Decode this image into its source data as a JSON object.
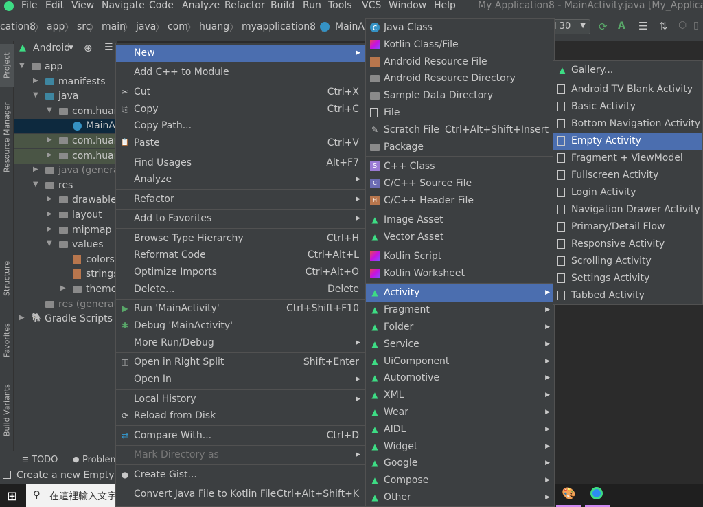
{
  "menubar": {
    "items": [
      "File",
      "Edit",
      "View",
      "Navigate",
      "Code",
      "Analyze",
      "Refactor",
      "Build",
      "Run",
      "Tools",
      "VCS",
      "Window",
      "Help"
    ],
    "title": "My Application8 - MainActivity.java [My_Applicatio"
  },
  "navbar": {
    "crumbs": [
      "cation8",
      "app",
      "src",
      "main",
      "java",
      "com",
      "huang",
      "myapplication8",
      "MainAc"
    ],
    "run_config": "l 30"
  },
  "left_strip": {
    "tabs": [
      "Project",
      "Resource Manager",
      "Structure",
      "Favorites",
      "Build Variants"
    ]
  },
  "project": {
    "view_selector": "Android",
    "tree": [
      {
        "label": "app",
        "indent": 0,
        "arrow": "down",
        "icon": "module"
      },
      {
        "label": "manifests",
        "indent": 1,
        "arrow": "right",
        "icon": "folder"
      },
      {
        "label": "java",
        "indent": 1,
        "arrow": "down",
        "icon": "folder"
      },
      {
        "label": "com.huar",
        "indent": 2,
        "arrow": "down",
        "icon": "package"
      },
      {
        "label": "MainA",
        "indent": 3,
        "arrow": "",
        "icon": "class"
      },
      {
        "label": "com.huar",
        "indent": 2,
        "arrow": "right",
        "icon": "package"
      },
      {
        "label": "com.huar",
        "indent": 2,
        "arrow": "right",
        "icon": "package"
      },
      {
        "label": "java (generate",
        "indent": 1,
        "arrow": "right",
        "icon": "folder"
      },
      {
        "label": "res",
        "indent": 1,
        "arrow": "down",
        "icon": "folder"
      },
      {
        "label": "drawable",
        "indent": 2,
        "arrow": "right",
        "icon": "folder"
      },
      {
        "label": "layout",
        "indent": 2,
        "arrow": "right",
        "icon": "folder"
      },
      {
        "label": "mipmap",
        "indent": 2,
        "arrow": "right",
        "icon": "folder"
      },
      {
        "label": "values",
        "indent": 2,
        "arrow": "down",
        "icon": "folder"
      },
      {
        "label": "colors.",
        "indent": 3,
        "arrow": "",
        "icon": "xml"
      },
      {
        "label": "strings",
        "indent": 3,
        "arrow": "",
        "icon": "xml"
      },
      {
        "label": "theme",
        "indent": 3,
        "arrow": "right",
        "icon": "folder"
      },
      {
        "label": "res (generate",
        "indent": 1,
        "arrow": "",
        "icon": "folder"
      },
      {
        "label": "Gradle Scripts",
        "indent": 0,
        "arrow": "right",
        "icon": "gradle"
      }
    ]
  },
  "bottom": {
    "tab1": "TODO",
    "tab2": "Problem",
    "status": "Create a new Empty Ac"
  },
  "taskbar": {
    "search_placeholder": "在這裡輸入文字"
  },
  "menu1": [
    {
      "label": "New",
      "shortcut": "",
      "sub": true,
      "sel": true,
      "sepBefore": false,
      "icon": ""
    },
    {
      "label": "Add C++ to Module",
      "shortcut": "",
      "sub": false,
      "sepBefore": true,
      "icon": ""
    },
    {
      "label": "Cut",
      "shortcut": "Ctrl+X",
      "sub": false,
      "sepBefore": true,
      "icon": "scissors"
    },
    {
      "label": "Copy",
      "shortcut": "Ctrl+C",
      "sub": false,
      "icon": "copy"
    },
    {
      "label": "Copy Path...",
      "shortcut": "",
      "sub": false,
      "icon": ""
    },
    {
      "label": "Paste",
      "shortcut": "Ctrl+V",
      "sub": false,
      "icon": "paste"
    },
    {
      "label": "Find Usages",
      "shortcut": "Alt+F7",
      "sub": false,
      "sepBefore": true,
      "icon": ""
    },
    {
      "label": "Analyze",
      "shortcut": "",
      "sub": true,
      "icon": ""
    },
    {
      "label": "Refactor",
      "shortcut": "",
      "sub": true,
      "sepBefore": true,
      "icon": ""
    },
    {
      "label": "Add to Favorites",
      "shortcut": "",
      "sub": true,
      "sepBefore": true,
      "icon": ""
    },
    {
      "label": "Browse Type Hierarchy",
      "shortcut": "Ctrl+H",
      "sub": false,
      "sepBefore": true,
      "icon": ""
    },
    {
      "label": "Reformat Code",
      "shortcut": "Ctrl+Alt+L",
      "sub": false,
      "icon": ""
    },
    {
      "label": "Optimize Imports",
      "shortcut": "Ctrl+Alt+O",
      "sub": false,
      "icon": ""
    },
    {
      "label": "Delete...",
      "shortcut": "Delete",
      "sub": false,
      "icon": ""
    },
    {
      "label": "Run 'MainActivity'",
      "shortcut": "Ctrl+Shift+F10",
      "sub": false,
      "sepBefore": true,
      "icon": "run"
    },
    {
      "label": "Debug 'MainActivity'",
      "shortcut": "",
      "sub": false,
      "icon": "debug"
    },
    {
      "label": "More Run/Debug",
      "shortcut": "",
      "sub": true,
      "icon": ""
    },
    {
      "label": "Open in Right Split",
      "shortcut": "Shift+Enter",
      "sub": false,
      "sepBefore": true,
      "icon": "split"
    },
    {
      "label": "Open In",
      "shortcut": "",
      "sub": true,
      "icon": ""
    },
    {
      "label": "Local History",
      "shortcut": "",
      "sub": true,
      "sepBefore": true,
      "icon": ""
    },
    {
      "label": "Reload from Disk",
      "shortcut": "",
      "sub": false,
      "icon": "reload"
    },
    {
      "label": "Compare With...",
      "shortcut": "Ctrl+D",
      "sub": false,
      "sepBefore": true,
      "icon": "compare"
    },
    {
      "label": "Mark Directory as",
      "shortcut": "",
      "sub": true,
      "sepBefore": true,
      "dis": true,
      "icon": ""
    },
    {
      "label": "Create Gist...",
      "shortcut": "",
      "sub": false,
      "sepBefore": true,
      "icon": "github"
    },
    {
      "label": "Convert Java File to Kotlin File",
      "shortcut": "Ctrl+Alt+Shift+K",
      "sub": false,
      "sepBefore": true,
      "icon": ""
    }
  ],
  "menu2": [
    {
      "label": "Java Class",
      "shortcut": "",
      "icon": "java-class",
      "sub": false
    },
    {
      "label": "Kotlin Class/File",
      "shortcut": "",
      "icon": "kotlin",
      "sub": false
    },
    {
      "label": "Android Resource File",
      "shortcut": "",
      "icon": "android-res",
      "sub": false
    },
    {
      "label": "Android Resource Directory",
      "shortcut": "",
      "icon": "folder",
      "sub": false
    },
    {
      "label": "Sample Data Directory",
      "shortcut": "",
      "icon": "folder",
      "sub": false
    },
    {
      "label": "File",
      "shortcut": "",
      "icon": "file",
      "sub": false
    },
    {
      "label": "Scratch File",
      "shortcut": "Ctrl+Alt+Shift+Insert",
      "icon": "scratch",
      "sub": false
    },
    {
      "label": "Package",
      "shortcut": "",
      "icon": "folder",
      "sub": false
    },
    {
      "label": "C++ Class",
      "shortcut": "",
      "icon": "cpp",
      "sub": false,
      "sepBefore": true
    },
    {
      "label": "C/C++ Source File",
      "shortcut": "",
      "icon": "cpp-src",
      "sub": false
    },
    {
      "label": "C/C++ Header File",
      "shortcut": "",
      "icon": "cpp-h",
      "sub": false
    },
    {
      "label": "Image Asset",
      "shortcut": "",
      "icon": "android",
      "sub": false,
      "sepBefore": true
    },
    {
      "label": "Vector Asset",
      "shortcut": "",
      "icon": "android",
      "sub": false
    },
    {
      "label": "Kotlin Script",
      "shortcut": "",
      "icon": "kotlin",
      "sub": false,
      "sepBefore": true
    },
    {
      "label": "Kotlin Worksheet",
      "shortcut": "",
      "icon": "kotlin",
      "sub": false
    },
    {
      "label": "Activity",
      "shortcut": "",
      "icon": "android",
      "sub": true,
      "sel": true,
      "sepBefore": true
    },
    {
      "label": "Fragment",
      "shortcut": "",
      "icon": "android",
      "sub": true
    },
    {
      "label": "Folder",
      "shortcut": "",
      "icon": "android",
      "sub": true
    },
    {
      "label": "Service",
      "shortcut": "",
      "icon": "android",
      "sub": true
    },
    {
      "label": "UiComponent",
      "shortcut": "",
      "icon": "android",
      "sub": true
    },
    {
      "label": "Automotive",
      "shortcut": "",
      "icon": "android",
      "sub": true
    },
    {
      "label": "XML",
      "shortcut": "",
      "icon": "android",
      "sub": true
    },
    {
      "label": "Wear",
      "shortcut": "",
      "icon": "android",
      "sub": true
    },
    {
      "label": "AIDL",
      "shortcut": "",
      "icon": "android",
      "sub": true
    },
    {
      "label": "Widget",
      "shortcut": "",
      "icon": "android",
      "sub": true
    },
    {
      "label": "Google",
      "shortcut": "",
      "icon": "android",
      "sub": true
    },
    {
      "label": "Compose",
      "shortcut": "",
      "icon": "android",
      "sub": true
    },
    {
      "label": "Other",
      "shortcut": "",
      "icon": "android",
      "sub": true
    }
  ],
  "menu3": [
    {
      "label": "Gallery...",
      "icon": "android"
    },
    {
      "label": "Android TV Blank Activity",
      "icon": "file",
      "sepBefore": true
    },
    {
      "label": "Basic Activity",
      "icon": "file"
    },
    {
      "label": "Bottom Navigation Activity",
      "icon": "file"
    },
    {
      "label": "Empty Activity",
      "icon": "file",
      "sel": true
    },
    {
      "label": "Fragment + ViewModel",
      "icon": "file"
    },
    {
      "label": "Fullscreen Activity",
      "icon": "file"
    },
    {
      "label": "Login Activity",
      "icon": "file"
    },
    {
      "label": "Navigation Drawer Activity",
      "icon": "file"
    },
    {
      "label": "Primary/Detail Flow",
      "icon": "file"
    },
    {
      "label": "Responsive Activity",
      "icon": "file"
    },
    {
      "label": "Scrolling Activity",
      "icon": "file"
    },
    {
      "label": "Settings Activity",
      "icon": "file"
    },
    {
      "label": "Tabbed Activity",
      "icon": "file"
    }
  ],
  "colors": {
    "accent": "#4b6eaf",
    "android": "#3ddc84",
    "bg": "#3c3f41",
    "editor": "#2b2b2b"
  }
}
